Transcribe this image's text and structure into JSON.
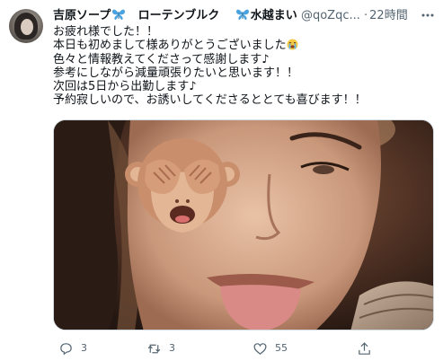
{
  "tweet": {
    "author_name": "吉原ソープ",
    "author_name_mid": "ローテンブルク",
    "author_name_end": "水越まい",
    "handle": "@qoZqc...",
    "separator": "·",
    "time": "22時間",
    "body_lines": [
      "お疲れ様でした！！",
      "本日も初めまして様ありがとうございました",
      "色々と情報教えてくださって感謝します♪",
      "参考にしながら減量頑張りたいと思います！！",
      "次回は5日から出勤します♪",
      "予約寂しいので、お誘いしてくださるととても喜びます！！"
    ],
    "emoji": "loudly-crying-face",
    "media_description_icon": "see-no-evil-monkey-sticker"
  },
  "actions": {
    "reply_count": "3",
    "retweet_count": "3",
    "like_count": "55",
    "share_count": ""
  },
  "colors": {
    "text_primary": "#0f1419",
    "text_secondary": "#536471",
    "border": "#cfd9de",
    "butterfly": "#4aa3df"
  }
}
